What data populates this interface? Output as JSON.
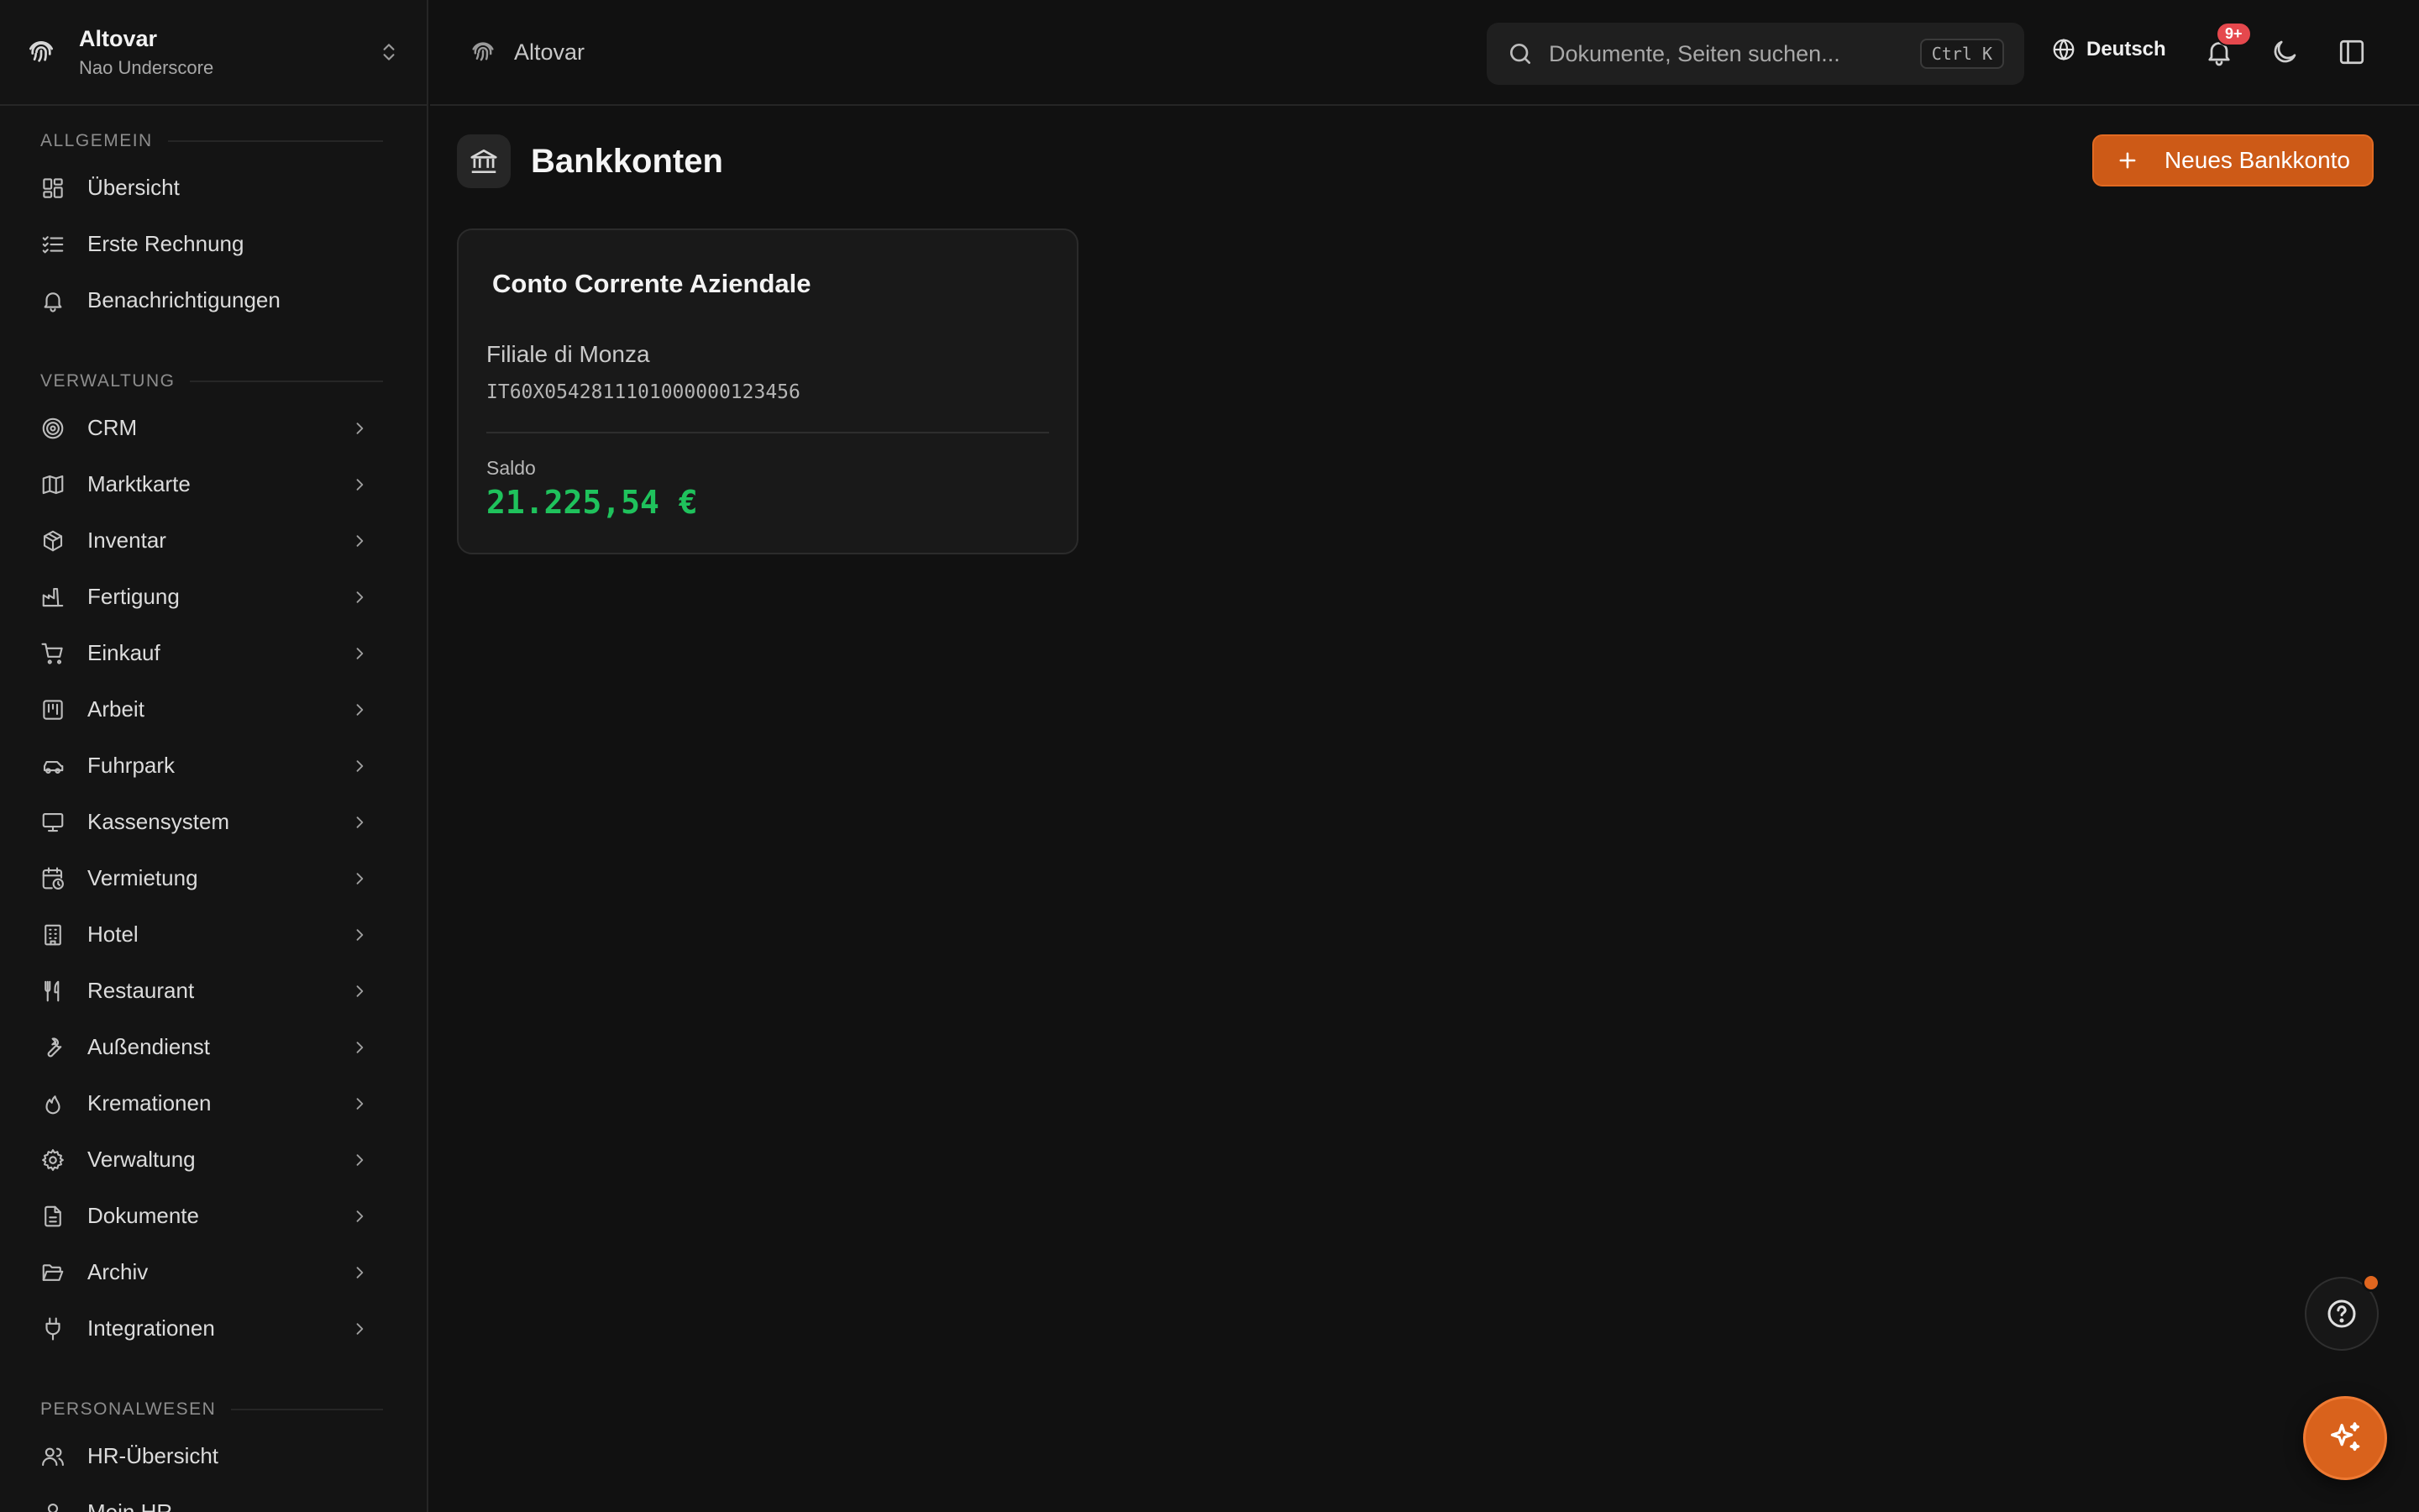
{
  "org": {
    "name": "Altovar",
    "subtitle": "Nao Underscore"
  },
  "sidebar": {
    "sections": [
      {
        "label": "ALLGEMEIN",
        "items": [
          {
            "label": "Übersicht",
            "icon": "dashboard-icon"
          },
          {
            "label": "Erste Rechnung",
            "icon": "checklist-icon"
          },
          {
            "label": "Benachrichtigungen",
            "icon": "bell-icon"
          }
        ]
      },
      {
        "label": "VERWALTUNG",
        "items": [
          {
            "label": "CRM",
            "icon": "target-icon"
          },
          {
            "label": "Marktkarte",
            "icon": "map-icon"
          },
          {
            "label": "Inventar",
            "icon": "package-icon"
          },
          {
            "label": "Fertigung",
            "icon": "factory-icon"
          },
          {
            "label": "Einkauf",
            "icon": "cart-icon"
          },
          {
            "label": "Arbeit",
            "icon": "kanban-icon"
          },
          {
            "label": "Fuhrpark",
            "icon": "car-icon"
          },
          {
            "label": "Kassensystem",
            "icon": "monitor-icon"
          },
          {
            "label": "Vermietung",
            "icon": "calendar-clock-icon"
          },
          {
            "label": "Hotel",
            "icon": "building-icon"
          },
          {
            "label": "Restaurant",
            "icon": "utensils-icon"
          },
          {
            "label": "Außendienst",
            "icon": "wrench-icon"
          },
          {
            "label": "Kremationen",
            "icon": "flame-icon"
          },
          {
            "label": "Verwaltung",
            "icon": "gear-icon"
          },
          {
            "label": "Dokumente",
            "icon": "file-icon"
          },
          {
            "label": "Archiv",
            "icon": "folder-open-icon"
          },
          {
            "label": "Integrationen",
            "icon": "plug-icon"
          }
        ]
      },
      {
        "label": "PERSONALWESEN",
        "items": [
          {
            "label": "HR-Übersicht",
            "icon": "users-icon"
          },
          {
            "label": "Mein HR",
            "icon": "user-icon"
          }
        ]
      }
    ]
  },
  "topbar": {
    "breadcrumb": "Altovar",
    "search_placeholder": "Dokumente, Seiten suchen...",
    "search_shortcut": "Ctrl K",
    "language": "Deutsch",
    "notification_count": "9+"
  },
  "page": {
    "title": "Bankkonten",
    "new_button": "Neues Bankkonto"
  },
  "accounts": [
    {
      "name": "Conto Corrente Aziendale",
      "branch": "Filiale di Monza",
      "iban": "IT60X0542811101000000123456",
      "balance_label": "Saldo",
      "balance": "21.225,54 €"
    }
  ],
  "colors": {
    "accent": "#cd5a17",
    "balance": "#1fc25c",
    "badge": "#e5484d"
  }
}
